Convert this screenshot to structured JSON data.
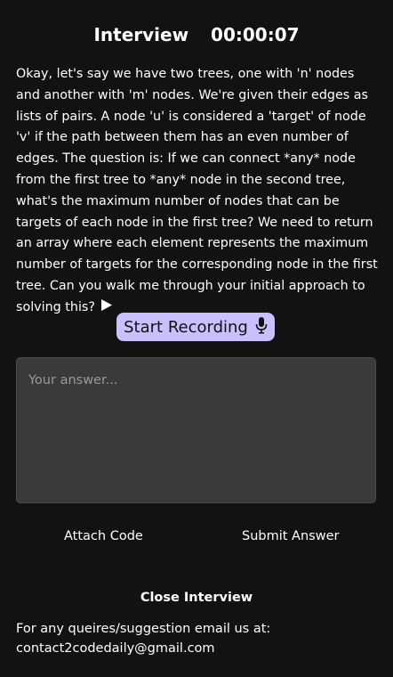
{
  "header": {
    "title": "Interview",
    "timer": "00:00:07"
  },
  "question": {
    "text": "Okay, let's say we have two trees, one with 'n' nodes and another with 'm' nodes. We're given their edges as lists of pairs. A node 'u' is considered a 'target' of node 'v' if the path between them has an even number of edges. The question is: If we can connect *any* node from the first tree to *any* node in the second tree, what's the maximum number of nodes that can be targets of each node in the first tree? We need to return an array where each element represents the maximum number of targets for the corresponding node in the first tree. Can you walk me through your initial approach to solving this?",
    "play_icon": "play-icon"
  },
  "record": {
    "label": "Start Recording",
    "icon": "microphone-icon",
    "color": "#c9c0ff"
  },
  "answer": {
    "placeholder": "Your answer...",
    "value": ""
  },
  "actions": {
    "attach_label": "Attach Code",
    "submit_label": "Submit Answer",
    "close_label": "Close Interview"
  },
  "footer": {
    "prompt": "For any queires/suggestion email us at:",
    "email": "contact2codedaily@gmail.com"
  }
}
